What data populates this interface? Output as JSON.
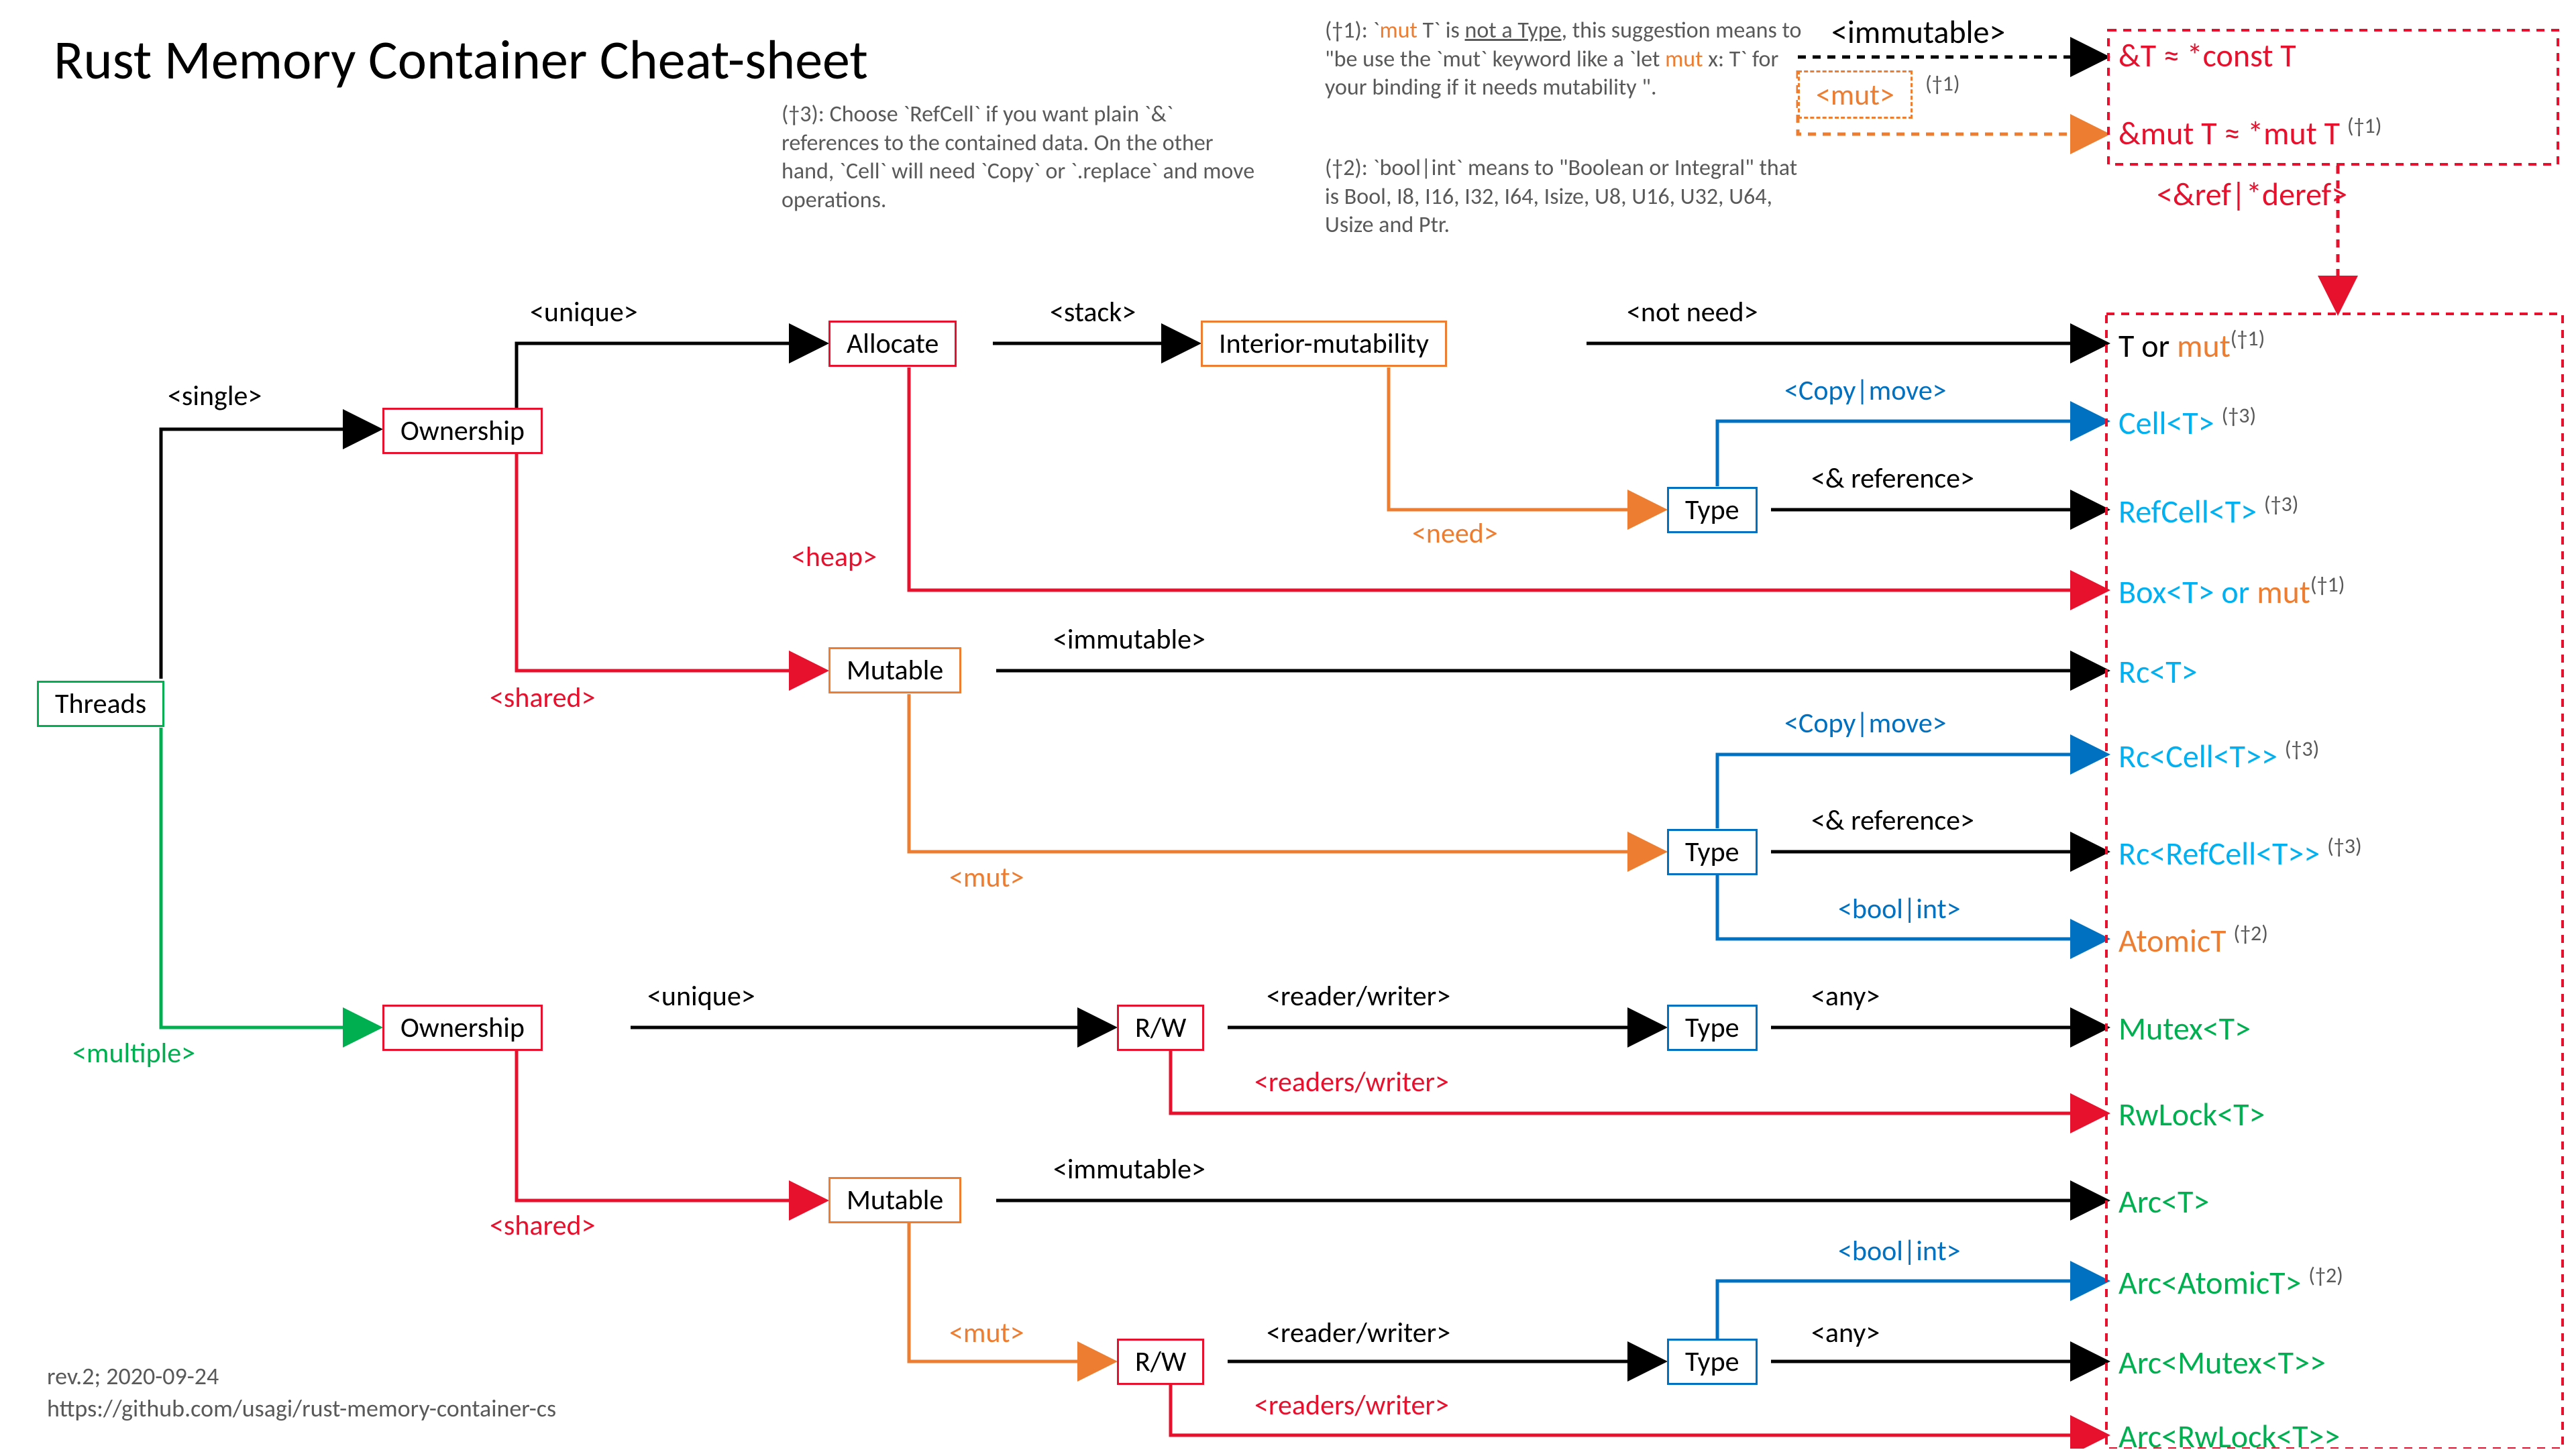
{
  "title": "Rust Memory Container Cheat-sheet",
  "footer": {
    "rev": "rev.2; 2020-09-24",
    "url": "https://github.com/usagi/rust-memory-container-cs"
  },
  "notes": {
    "n1_pre": "(†1): `",
    "n1_mut": "mut",
    "n1_mid": " T` is ",
    "n1_notatype": "not a Type",
    "n1_post": ", this suggestion means to \"be use the `mut` keyword like a `let ",
    "n1_mut2": "mut",
    "n1_tail": " x: T` for your binding if it needs mutability \".",
    "n2": "(†2): `bool|int` means to \"Boolean or Integral\" that is Bool, I8, I16, I32, I64, Isize, U8, U16, U32, U64, Usize and Ptr.",
    "n3": "(†3): Choose `RefCell` if you want plain `&` references to the contained data. On the other hand, `Cell` will need `Copy` or `.replace` and move operations."
  },
  "boxes": {
    "threads": "Threads",
    "ownership1": "Ownership",
    "ownership2": "Ownership",
    "allocate": "Allocate",
    "mutable1": "Mutable",
    "mutable2": "Mutable",
    "interior": "Interior-mutability",
    "rw1": "R/W",
    "rw2": "R/W",
    "type1": "Type",
    "type2": "Type",
    "type3": "Type",
    "type4": "Type"
  },
  "edges": {
    "single": "<single>",
    "multiple": "<multiple>",
    "unique1": "<unique>",
    "shared1": "<shared>",
    "unique2": "<unique>",
    "shared2": "<shared>",
    "stack": "<stack>",
    "heap": "<heap>",
    "notneed": "<not need>",
    "need": "<need>",
    "copymove1": "<Copy|move>",
    "ref1": "<& reference>",
    "immutable1": "<immutable>",
    "mut1": "<mut>",
    "copymove2": "<Copy|move>",
    "ref2": "<& reference>",
    "boolint1": "<bool|int>",
    "readerwriter1": "<reader/writer>",
    "readerswriter1": "<readers/writer>",
    "any1": "<any>",
    "immutable2": "<immutable>",
    "mut2": "<mut>",
    "boolint2": "<bool|int>",
    "readerwriter2": "<reader/writer>",
    "readerswriter2": "<readers/writer>",
    "any2": "<any>",
    "topImmutable": "<immutable>",
    "topMut": "<mut>",
    "topMutFn": "(†1)",
    "refderef": "<&ref|*deref>"
  },
  "outputs": {
    "refconst": "&T ≈ *const T",
    "refmut_pre": "&mut T ≈ *mut T ",
    "refmut_fn": "(†1)",
    "tormut_pre": "T or ",
    "tormut_mut": "mut",
    "tormut_fn": "(†1)",
    "cell": "Cell<T>",
    "cell_fn": "(†3)",
    "refcell": "RefCell<T>",
    "refcell_fn": "(†3)",
    "box_pre": "Box<T> or ",
    "box_mut": "mut",
    "box_fn": "(†1)",
    "rc": "Rc<T>",
    "rccell": "Rc<Cell<T>>",
    "rccell_fn": "(†3)",
    "rcrefcell": "Rc<RefCell<T>>",
    "rcrefcell_fn": "(†3)",
    "atomict": "AtomicT",
    "atomict_fn": "(†2)",
    "mutex": "Mutex<T>",
    "rwlock": "RwLock<T>",
    "arc": "Arc<T>",
    "arcatomic": "Arc<AtomicT>",
    "arcatomic_fn": "(†2)",
    "arcmutex": "Arc<Mutex<T>>",
    "arcrwlock": "Arc<RwLock<T>>"
  }
}
